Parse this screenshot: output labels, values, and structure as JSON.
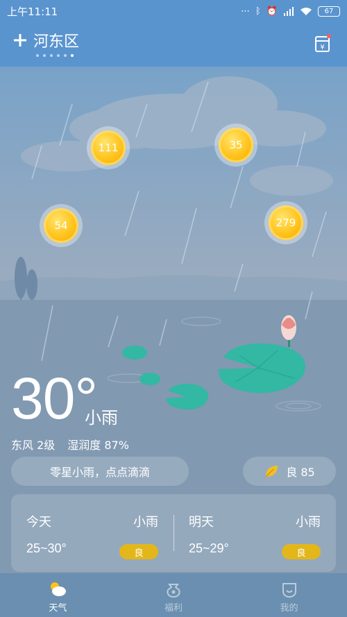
{
  "status_bar": {
    "time": "上午11:11",
    "battery": "67"
  },
  "header": {
    "location": "河东区",
    "page_dots": 6,
    "active_dot": 5
  },
  "coins": [
    {
      "value": "111"
    },
    {
      "value": "35"
    },
    {
      "value": "54"
    },
    {
      "value": "279"
    }
  ],
  "current": {
    "temperature": "30°",
    "condition": "小雨",
    "wind": "东风 2级",
    "humidity": "湿润度 87%",
    "description": "零星小雨，点点滴滴",
    "aqi": "良 85"
  },
  "forecast": [
    {
      "day": "今天",
      "condition": "小雨",
      "range": "25~30°",
      "quality": "良"
    },
    {
      "day": "明天",
      "condition": "小雨",
      "range": "25~29°",
      "quality": "良"
    }
  ],
  "tabs": [
    {
      "label": "天气",
      "icon": "weather-icon",
      "active": true
    },
    {
      "label": "福利",
      "icon": "gift-bag-icon",
      "active": false
    },
    {
      "label": "我的",
      "icon": "profile-icon",
      "active": false
    }
  ],
  "colors": {
    "sky_top": "#5a94cf",
    "sky_mid": "#93a8bd",
    "water": "#8199b1",
    "lily_pad": "#32b8a3",
    "badge": "#e3b71a",
    "tabbar": "#6a8fb0"
  }
}
